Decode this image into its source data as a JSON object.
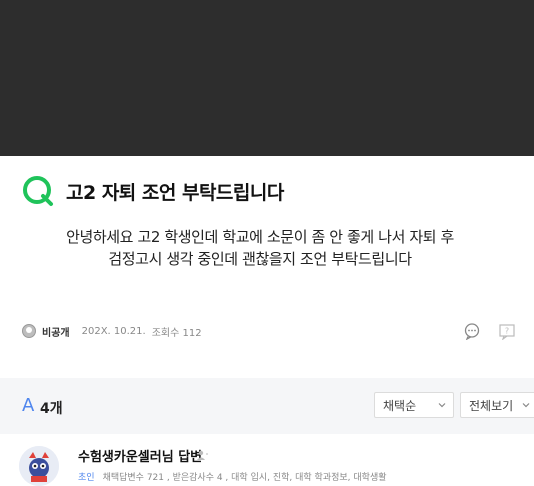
{
  "question": {
    "title": "고2 자퇴 조언 부탁드립니다",
    "body_line1": "안녕하세요 고2 학생인데 학교에 소문이 좀 안 좋게 나서 자퇴 후",
    "body_line2": "검정고시 생각 중인데 괜찮을지 조언 부탁드립니다",
    "author": "비공개",
    "date": "202X. 10.21.",
    "views": "조회수 112",
    "report_badge": "?"
  },
  "answers": {
    "count_label": "4개",
    "sort_select": "채택순",
    "view_select": "전체보기"
  },
  "answer": {
    "name": "수험생카운셀러님 답변",
    "grade": "초인",
    "stats": "채택답변수 721 , 받은감사수 4 , 대학 입시, 진학, 대학 학과정보, 대학생활"
  },
  "colors": {
    "dark_band": "#2d2d2d",
    "accent_green": "#1fc35a",
    "accent_blue": "#4f86ee"
  }
}
